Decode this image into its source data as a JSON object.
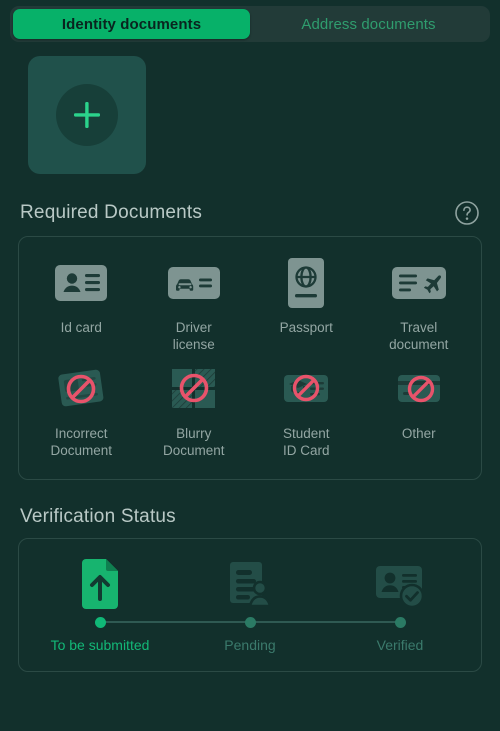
{
  "tabs": [
    {
      "label": "Identity documents",
      "state": "active",
      "name": "tab-identity-documents"
    },
    {
      "label": "Address documents",
      "state": "inactive",
      "name": "tab-address-documents"
    }
  ],
  "upload": {
    "tile_name": "add-document-tile",
    "icon": "plus-icon"
  },
  "required_section": {
    "title": "Required Documents",
    "help_icon": "help-circle-icon"
  },
  "documents": [
    {
      "label": "Id card",
      "icon": "id-card-icon"
    },
    {
      "label": "Driver\nlicense",
      "icon": "driver-license-icon"
    },
    {
      "label": "Passport",
      "icon": "passport-icon"
    },
    {
      "label": "Travel\ndocument",
      "icon": "travel-document-icon"
    },
    {
      "label": "Incorrect\nDocument",
      "icon": "incorrect-document-icon"
    },
    {
      "label": "Blurry\nDocument",
      "icon": "blurry-document-icon"
    },
    {
      "label": "Student\nID Card",
      "icon": "student-id-card-icon"
    },
    {
      "label": "Other",
      "icon": "other-document-icon"
    }
  ],
  "verification_section": {
    "title": "Verification Status"
  },
  "steps": [
    {
      "label": "To be submitted",
      "state": "active",
      "icon": "upload-file-icon"
    },
    {
      "label": "Pending",
      "state": "inactive",
      "icon": "document-review-icon"
    },
    {
      "label": "Verified",
      "state": "inactive",
      "icon": "verified-id-icon"
    }
  ],
  "colors": {
    "background": "#12302c",
    "accent_green": "#07b169",
    "active_green": "#10b877",
    "muted_text": "#93a6a3",
    "card_border": "#2b4a45",
    "icon_fill": "#7e9491",
    "icon_fill_dim": "#234d47",
    "ban_red": "#e8536b"
  }
}
